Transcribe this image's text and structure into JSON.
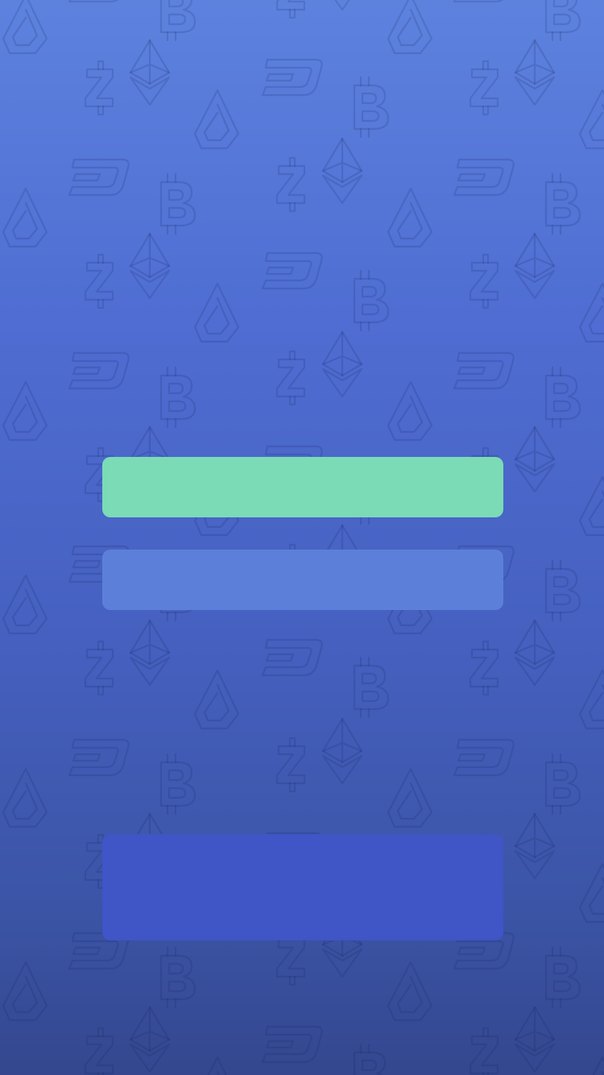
{
  "screen": {
    "background_colors": [
      "#5d82de",
      "#4f6dd2",
      "#4560bf",
      "#3b54a5",
      "#34478f"
    ],
    "pattern_icons": [
      "bitcoin-icon",
      "ethereum-icon",
      "zcash-icon",
      "dash-icon",
      "lisk-icon"
    ]
  },
  "actions": {
    "primary": {
      "label": "",
      "color": "#7adbb6"
    },
    "secondary": {
      "label": "",
      "color": "#5c80d9"
    }
  },
  "bottom_panel": {
    "color": "#4055c6"
  }
}
